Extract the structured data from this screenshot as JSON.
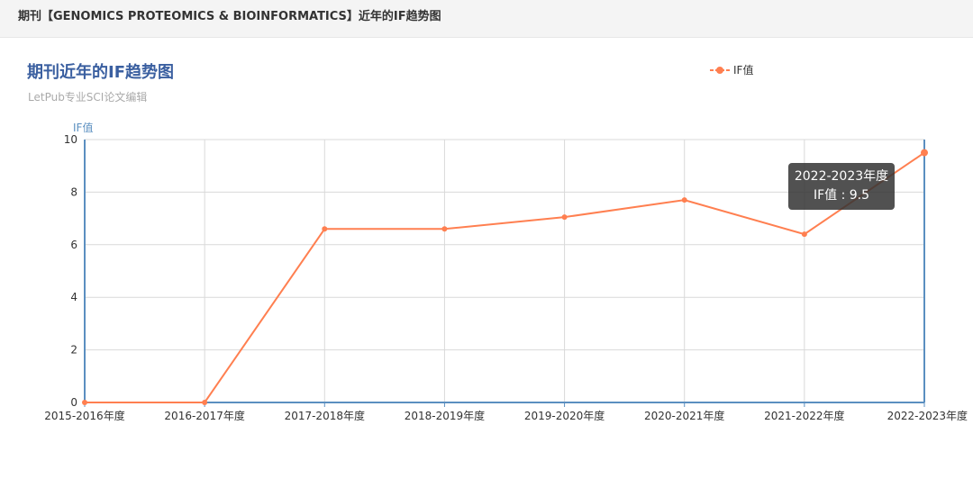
{
  "header": {
    "title": "期刊【GENOMICS PROTEOMICS & BIOINFORMATICS】近年的IF趋势图"
  },
  "chart_data": {
    "type": "line",
    "title": "期刊近年的IF趋势图",
    "subtitle": "LetPub专业SCI论文编辑",
    "ylabel": "IF值",
    "ylim": [
      0,
      10
    ],
    "yticks": [
      0,
      2,
      4,
      6,
      8,
      10
    ],
    "categories": [
      "2015-2016年度",
      "2016-2017年度",
      "2017-2018年度",
      "2018-2019年度",
      "2019-2020年度",
      "2020-2021年度",
      "2021-2022年度",
      "2022-2023年度"
    ],
    "series": [
      {
        "name": "IF值",
        "values": [
          0,
          0,
          6.6,
          6.6,
          7.05,
          7.7,
          6.4,
          9.5
        ],
        "color": "#ff7f50"
      }
    ],
    "legend_position": "top-right",
    "grid": true,
    "tooltip": {
      "category": "2022-2023年度",
      "label": "IF值 : 9.5"
    }
  }
}
